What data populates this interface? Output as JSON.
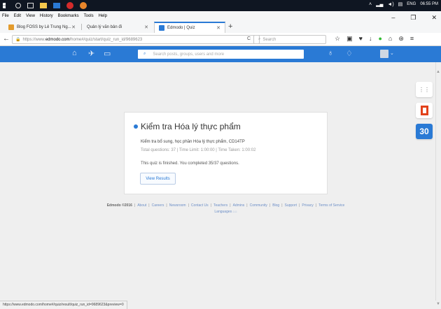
{
  "taskbar": {
    "lang": "ENG",
    "time": "06:55 PM"
  },
  "menu": {
    "items": [
      "File",
      "Edit",
      "View",
      "History",
      "Bookmarks",
      "Tools",
      "Help"
    ]
  },
  "tabs": [
    {
      "title": "Blog FOSS by Lê Trung Ng...",
      "favicon_color": "#e39b2d"
    },
    {
      "title": "Quản lý văn bản đi",
      "favicon_color": "#ffffff"
    },
    {
      "title": "Edmodo | Quiz",
      "favicon_color": "#2a7ad5"
    }
  ],
  "url": {
    "prefix": "https://www.",
    "host": "edmodo.com",
    "path": "/home#/quiz/start/quiz_run_id/9689623"
  },
  "browser_search": {
    "placeholder": "Search"
  },
  "edmodo": {
    "search_placeholder": "Search posts, groups, users and more",
    "colors": {
      "brand": "#2a7ad5"
    }
  },
  "quiz": {
    "title": "Kiểm tra Hóa lý thực phẩm",
    "description": "Kiểm tra bổ sung, học phần Hóa lý thực phẩm, CD14TP",
    "stats": "Total questions: 37  |  Time Limit: 1:00:00  |  Time Taken: 1:00:02",
    "finished": "This quiz is finished. You completed 35/37 questions.",
    "view_results": "View Results"
  },
  "footer": {
    "copyright": "Edmodo ©2016",
    "links": [
      "About",
      "Careers",
      "Newsroom",
      "Contact Us",
      "Teachers",
      "Admins",
      "Community",
      "Blog",
      "Support",
      "Privacy",
      "Terms of Service"
    ],
    "language": "Languages"
  },
  "right_tools": {
    "calendar_day": "30"
  },
  "status_url": "https://www.edmodo.com/home#/quiz/result/quiz_run_id=9689623&preview=0"
}
